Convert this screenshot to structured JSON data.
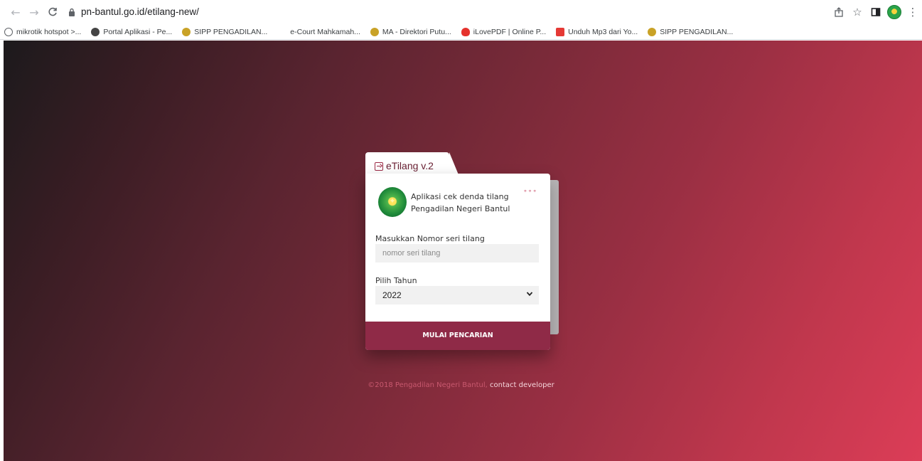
{
  "browser": {
    "url": "pn-bantul.go.id/etilang-new/",
    "bookmarks": [
      {
        "label": "mikrotik hotspot >...",
        "color": "#5f6368"
      },
      {
        "label": "Portal Aplikasi - Pe...",
        "color": "#444"
      },
      {
        "label": "SIPP PENGADILAN...",
        "color": "#c9a227"
      },
      {
        "label": "e-Court Mahkamah...",
        "color": ""
      },
      {
        "label": "MA - Direktori Putu...",
        "color": "#c9a227"
      },
      {
        "label": "iLovePDF | Online P...",
        "color": "#e5322d"
      },
      {
        "label": "Unduh Mp3 dari Yo...",
        "color": "#e53935"
      },
      {
        "label": "SIPP PENGADILAN...",
        "color": "#c9a227"
      }
    ]
  },
  "app": {
    "tab_title": "eTilang v.2",
    "line1": "Aplikasi cek denda tilang",
    "line2": "Pengadilan Negeri Bantul",
    "dots": "∘∘∘"
  },
  "form": {
    "serial_label": "Masukkan Nomor seri tilang",
    "serial_placeholder": "nomor seri tilang",
    "year_label": "Pilih Tahun",
    "year_value": "2022",
    "submit_label": "MULAI PENCARIAN"
  },
  "footer": {
    "copyright": "©2018 Pengadilan Negeri Bantul,",
    "link": "contact developer"
  },
  "colors": {
    "accent": "#8f2a47",
    "bg_start": "#1c1a1c",
    "bg_end": "#dc3d57"
  }
}
